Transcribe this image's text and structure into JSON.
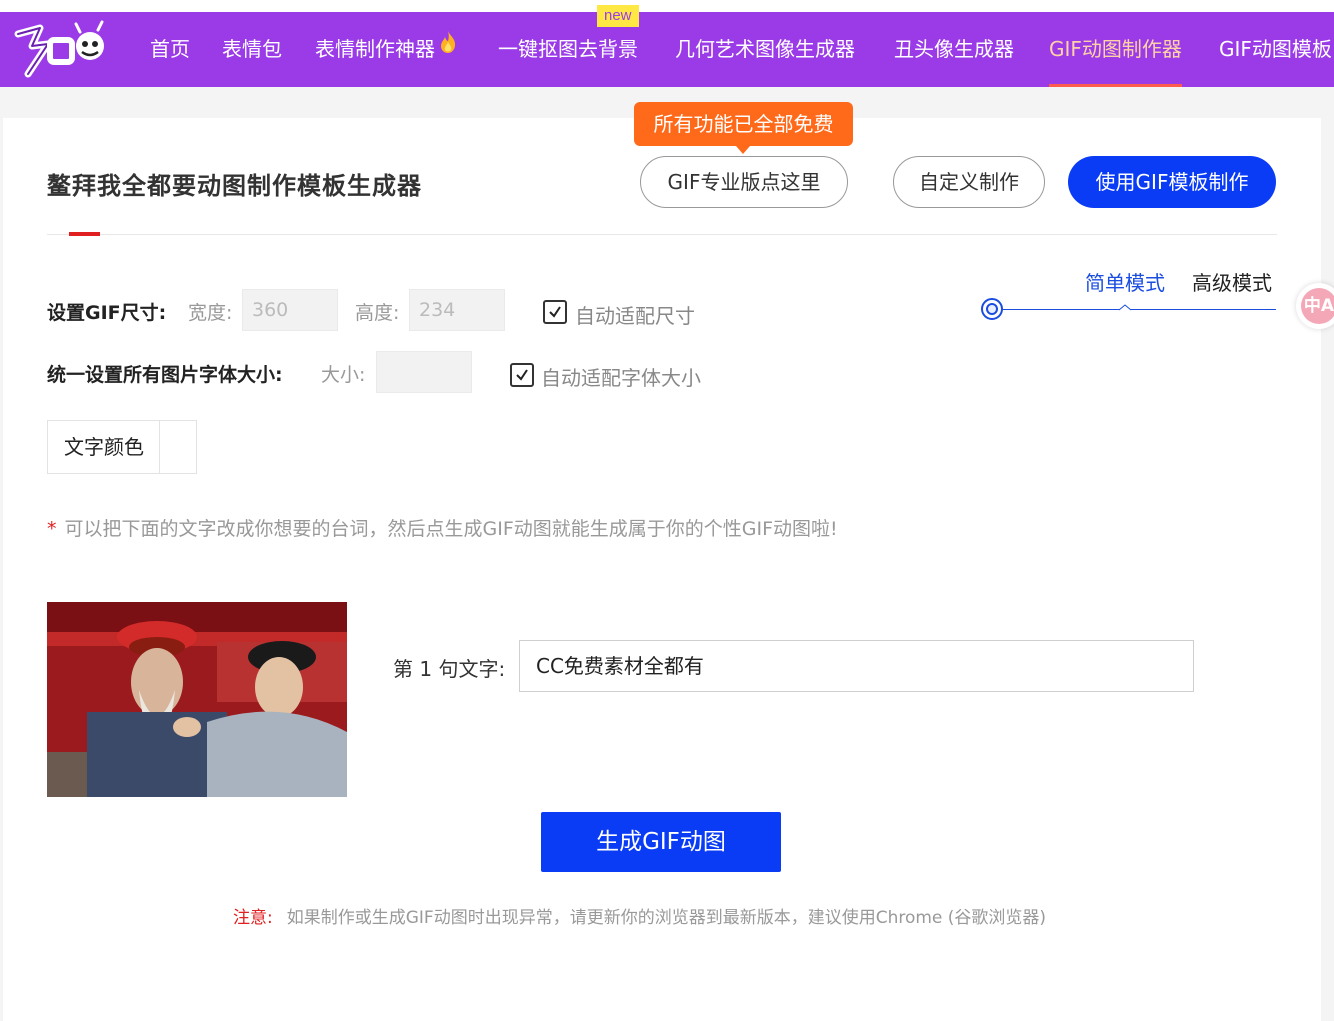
{
  "nav": {
    "items": [
      {
        "label": "首页"
      },
      {
        "label": "表情包"
      },
      {
        "label": "表情制作神器"
      },
      {
        "label": "一键抠图去背景"
      },
      {
        "label": "几何艺术图像生成器"
      },
      {
        "label": "丑头像生成器"
      },
      {
        "label": "GIF动图制作器"
      },
      {
        "label": "GIF动图模板"
      }
    ],
    "new_badge": "new",
    "active_item": "GIF动图制作器",
    "accent_color": "#9b3be8"
  },
  "header": {
    "title": "鳌拜我全都要动图制作模板生成器",
    "promo": "所有功能已全部免费",
    "btn_pro": "GIF专业版点这里",
    "btn_custom": "自定义制作",
    "btn_template": "使用GIF模板制作",
    "primary_color": "#0b3cf5",
    "promo_color": "#ff6a1a"
  },
  "settings": {
    "size_label": "设置GIF尺寸:",
    "width_label": "宽度:",
    "width_value": "360",
    "height_label": "高度:",
    "height_value": "234",
    "auto_size_label": "自动适配尺寸",
    "auto_size_checked": true,
    "font_label": "统一设置所有图片字体大小:",
    "font_size_label": "大小:",
    "font_size_value": "",
    "auto_font_label": "自动适配字体大小",
    "auto_font_checked": true,
    "text_color_label": "文字颜色"
  },
  "mode": {
    "simple": "简单模式",
    "advanced": "高级模式",
    "active": "简单模式"
  },
  "hint": {
    "star": "*",
    "text": "可以把下面的文字改成你想要的台词，然后点生成GIF动图就能生成属于你的个性GIF动图啦!"
  },
  "lines": [
    {
      "label": "第 1 句文字:",
      "value": "CC免费素材全都有"
    }
  ],
  "generate_button": "生成GIF动图",
  "notice": {
    "prefix": "注意:",
    "text": "如果制作或生成GIF动图时出现异常，请更新你的浏览器到最新版本，建议使用Chrome (谷歌浏览器)"
  },
  "translate_fab": "中A"
}
